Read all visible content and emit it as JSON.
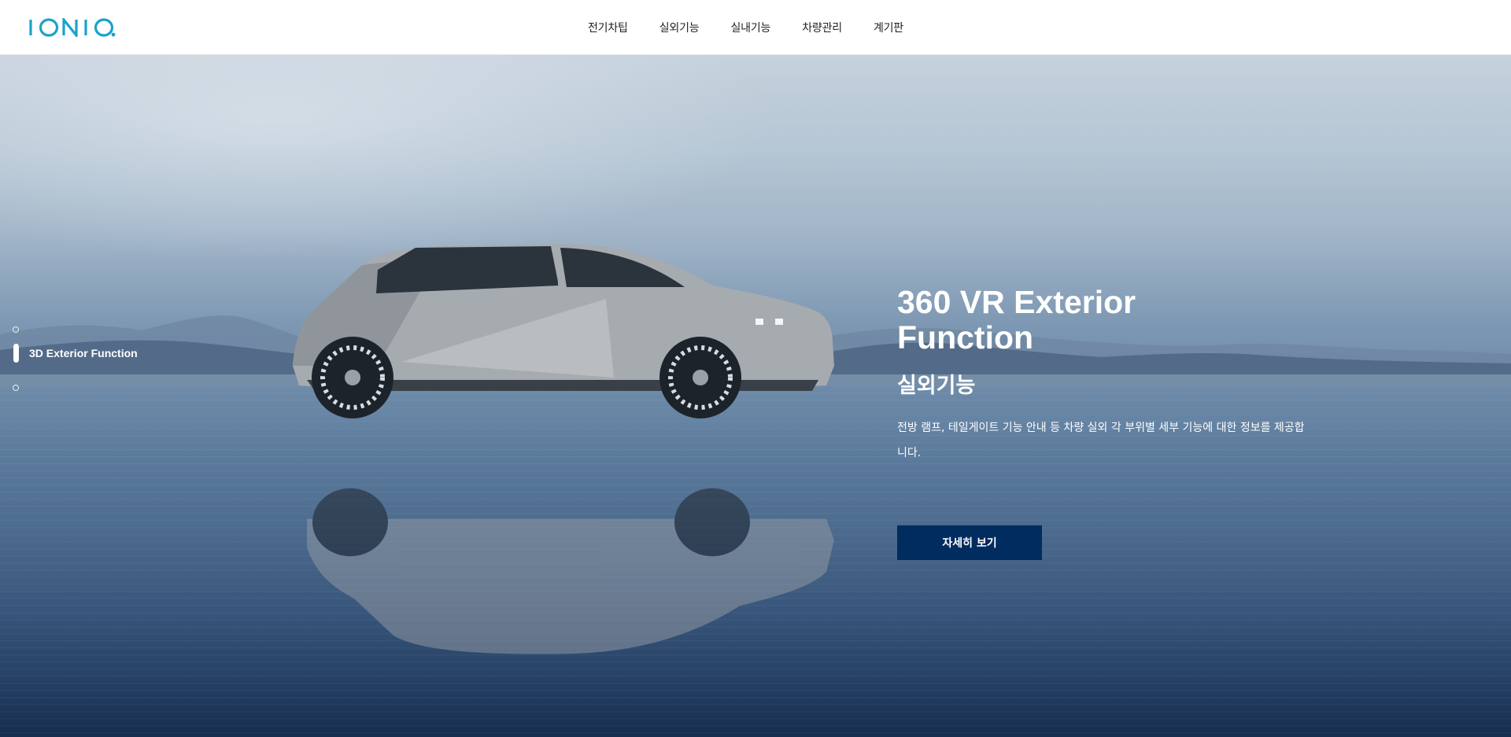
{
  "brand": {
    "logo_text": "IONIQ",
    "logo_color": "#1aa3c9"
  },
  "nav": {
    "items": [
      {
        "label": "전기차팁"
      },
      {
        "label": "실외기능"
      },
      {
        "label": "실내기능"
      },
      {
        "label": "차량관리"
      },
      {
        "label": "계기판"
      }
    ]
  },
  "hero": {
    "pager": {
      "active_label": "3D Exterior Function",
      "total": 3,
      "active_index": 2
    },
    "title": "360 VR Exterior Function",
    "subtitle": "실외기능",
    "description": "전방 램프, 테일게이트 기능 안내 등 차량 실외 각 부위별 세부 기능에 대한 정보를 제공합니다.",
    "button_label": "자세히 보기"
  },
  "colors": {
    "button_bg": "#002c5f",
    "text_on_hero": "#ffffff"
  }
}
